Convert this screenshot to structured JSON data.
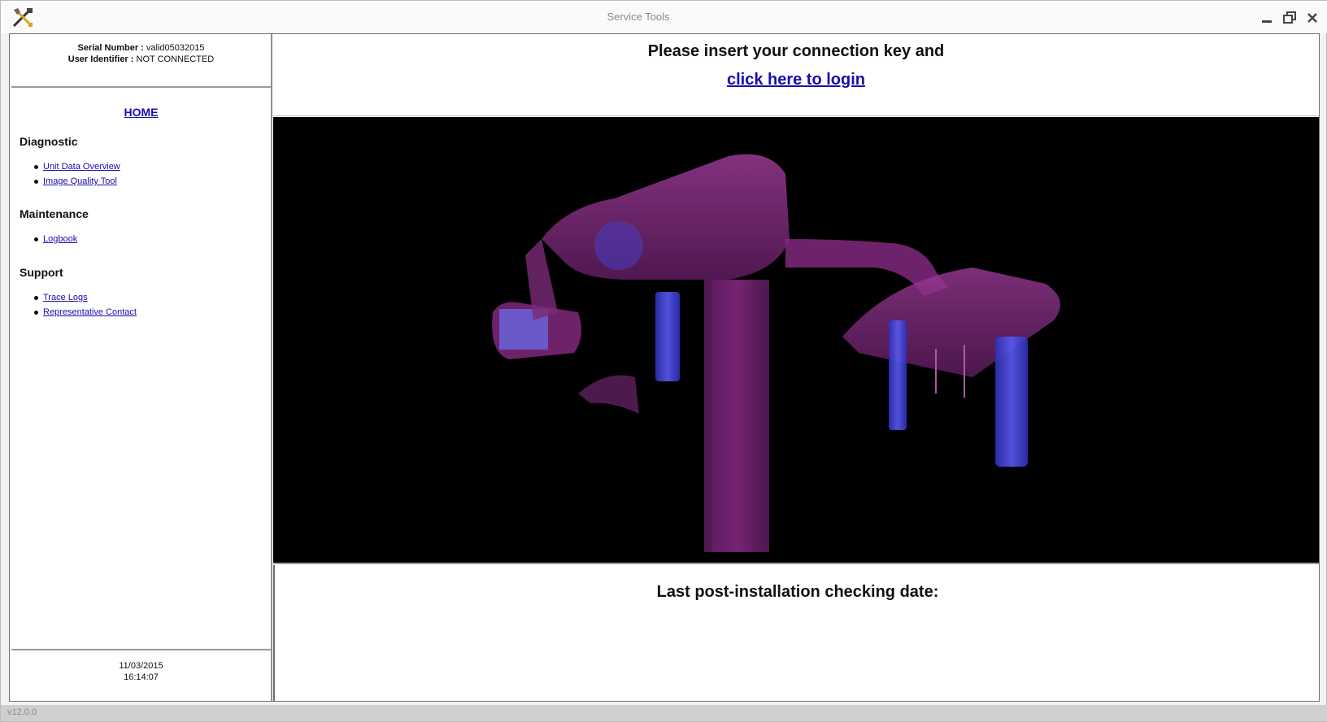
{
  "window": {
    "title": "Service Tools",
    "app_icon": "tools-icon"
  },
  "sidebar": {
    "serial_label": "Serial Number :",
    "serial_value": "valid05032015",
    "user_label": "User Identifier :",
    "user_value": "NOT CONNECTED",
    "home_label": "HOME",
    "sections": [
      {
        "title": "Diagnostic",
        "items": [
          "Unit Data Overview",
          "Image Quality Tool"
        ]
      },
      {
        "title": "Maintenance",
        "items": [
          "Logbook"
        ]
      },
      {
        "title": "Support",
        "items": [
          "Trace Logs",
          "Representative Contact"
        ]
      }
    ],
    "footer_date": "11/03/2015",
    "footer_time": "16:14:07"
  },
  "main": {
    "login_prompt": "Please insert your connection key and",
    "login_link": "click here to login",
    "check_label": "Last post-installation checking date:"
  },
  "statusbar": {
    "version": "v12.0.0"
  },
  "colors": {
    "link": "#1a0dab",
    "device_purple": "#8a2a86",
    "device_blue": "#4a4ae0",
    "viewer_background": "#000000"
  }
}
